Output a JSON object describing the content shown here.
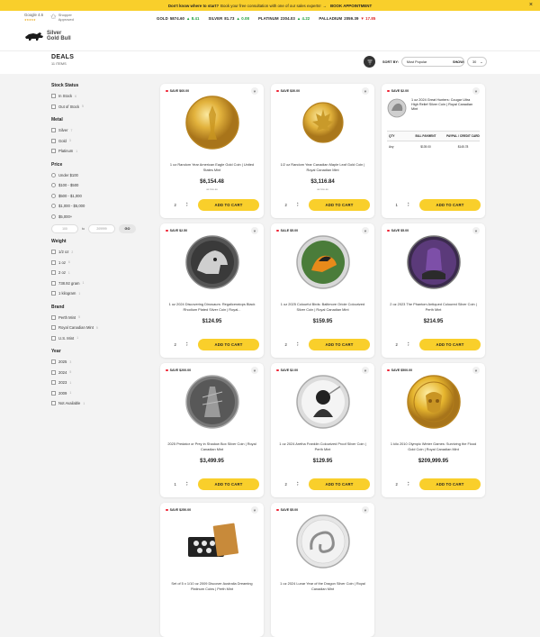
{
  "announcement": {
    "bold": "Don't know where to start?",
    "text": "Book your free consultation with one of our sales experts!",
    "link": "BOOK APPOINTMENT",
    "close": "×"
  },
  "header": {
    "google_rating": "Google",
    "google_rating_value": "4.6",
    "google_sub": "★★★★★",
    "shopper_approved": "Shopper Approved",
    "logo_text_1": "Silver",
    "logo_text_2": "Gold Bull",
    "metals": [
      {
        "name": "GOLD",
        "price": "5874.60",
        "change": "▲ 8.41",
        "dir": "up"
      },
      {
        "name": "SILVER",
        "price": "81.73",
        "change": "▲ 0.08",
        "dir": "up"
      },
      {
        "name": "PLATINUM",
        "price": "2304.03",
        "change": "▲ 4.22",
        "dir": "up"
      },
      {
        "name": "PALLADIUM",
        "price": "2059.39",
        "change": "▼ 17.85",
        "dir": "down"
      }
    ]
  },
  "page": {
    "title": "DEALS",
    "count": "11 ITEMS",
    "sort_label": "SORT BY:",
    "sort_value": "Most Popular",
    "show_label": "SHOW:",
    "show_value": "30"
  },
  "filters": {
    "stock": {
      "title": "Stock Status",
      "options": [
        {
          "label": "In Stock",
          "count": "6"
        },
        {
          "label": "Out of Stock",
          "count": "5"
        }
      ]
    },
    "metal": {
      "title": "Metal",
      "options": [
        {
          "label": "Silver",
          "count": "7"
        },
        {
          "label": "Gold",
          "count": "3"
        },
        {
          "label": "Platinum",
          "count": "1"
        }
      ]
    },
    "price": {
      "title": "Price",
      "options": [
        {
          "label": "Under $100"
        },
        {
          "label": "$100 - $500"
        },
        {
          "label": "$500 - $1,000"
        },
        {
          "label": "$1,000 - $5,000"
        },
        {
          "label": "$5,000+"
        }
      ],
      "min_placeholder": "100",
      "max_placeholder": "209999",
      "to": "to",
      "go": "GO"
    },
    "weight": {
      "title": "Weight",
      "options": [
        {
          "label": "1/2 oz",
          "count": "2"
        },
        {
          "label": "1 oz",
          "count": "6"
        },
        {
          "label": "2 oz",
          "count": "1"
        },
        {
          "label": "738.92 gram",
          "count": "1"
        },
        {
          "label": "1 kilogram",
          "count": "1"
        }
      ]
    },
    "brand": {
      "title": "Brand",
      "options": [
        {
          "label": "Perth Mint",
          "count": "5"
        },
        {
          "label": "Royal Canadian Mint",
          "count": "5"
        },
        {
          "label": "U.S. Mint",
          "count": "1"
        }
      ]
    },
    "year": {
      "title": "Year",
      "options": [
        {
          "label": "2025",
          "count": "3"
        },
        {
          "label": "2024",
          "count": "5"
        },
        {
          "label": "2023",
          "count": "1"
        },
        {
          "label": "2009",
          "count": "1"
        },
        {
          "label": "Not Available",
          "count": "1"
        }
      ]
    }
  },
  "products": [
    {
      "save": "SAVE $60.00",
      "title": "1 oz Random Year American Eagle Gold Coin | United States Mint",
      "price": "$6,154.48",
      "aslow": "as low as",
      "qty": "2",
      "cart": "ADD TO CART"
    },
    {
      "save": "SAVE $30.00",
      "title": "1/2 oz Random Year Canadian Maple Leaf Gold Coin | Royal Canadian Mint",
      "price": "$3,116.84",
      "aslow": "as low as",
      "qty": "2",
      "cart": "ADD TO CART"
    },
    {
      "save": "SAVE $2.00",
      "title": "1 oz 2024 Great Hunters: Cougar Ultra High Relief Silver Coin | Royal Canadian Mint",
      "table_headers": [
        "QTY",
        "BILL PAYMENT",
        "PAYPAL / CREDIT CARD"
      ],
      "table_row": [
        "Any",
        "$139.00",
        "$145.78"
      ],
      "qty": "1",
      "cart": "ADD TO CART"
    },
    {
      "save": "SAVE $2.50",
      "title": "1 oz 2024 Discovering Dinosaurs: Regaliceratops Black Rhodium Plated Silver Coin | Royal...",
      "price": "$124.95",
      "qty": "2",
      "cart": "ADD TO CART"
    },
    {
      "save": "SALE $5.00",
      "title": "1 oz 2025 Colourful Birds: Baltimore Oriole Colourized Silver Coin | Royal Canadian Mint",
      "price": "$159.95",
      "qty": "2",
      "cart": "ADD TO CART"
    },
    {
      "save": "SAVE $5.00",
      "title": "2 oz 2023 The Phantom Antiqued Coloured Silver Coin | Perth Mint",
      "price": "$214.95",
      "qty": "2",
      "cart": "ADD TO CART"
    },
    {
      "save": "SAVE $200.00",
      "title": "2025 Predator or Prey in Shadow Box Silver Coin | Royal Canadian Mint",
      "price": "$3,499.95",
      "qty": "1",
      "cart": "ADD TO CART"
    },
    {
      "save": "SAVE $2.00",
      "title": "1 oz 2024 Aretha Franklin Colourized Proof Silver Coin | Perth Mint",
      "price": "$129.95",
      "qty": "2",
      "cart": "ADD TO CART"
    },
    {
      "save": "SAVE $500.00",
      "title": "1 kilo 2010 Olympic Winter Games: Surviving the Flood Gold Coin | Royal Canadian Mint",
      "price": "$209,999.95",
      "qty": "2",
      "cart": "ADD TO CART"
    },
    {
      "save": "SAVE $250.00",
      "title": "Set of 5 x 1/10 oz 2009 Discover Australia Dreaming Platinum Coins | Perth Mint"
    },
    {
      "save": "SAVE $5.00",
      "title": "1 oz 2024 Lunar Year of the Dragon Silver Coin | Royal Canadian Mint"
    }
  ],
  "colors": {
    "accent": "#f9cf2b",
    "up": "#1a9b3c",
    "down": "#dd2222",
    "save_dot": "#ee2233"
  }
}
